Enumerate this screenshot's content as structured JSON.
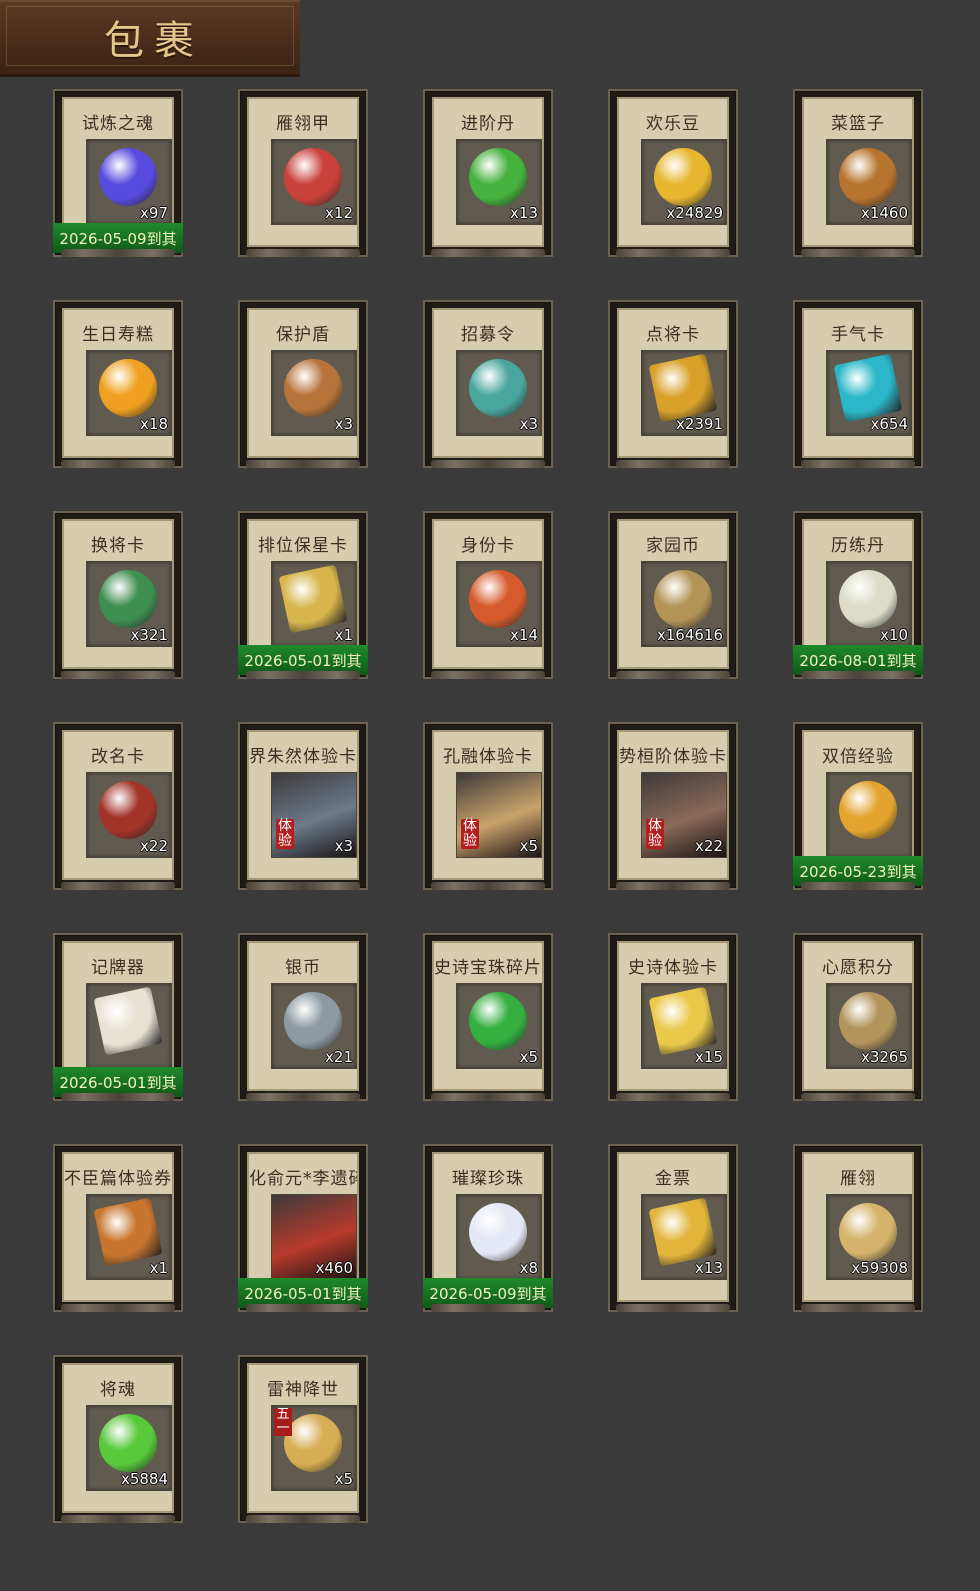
{
  "title": "包裹",
  "items": [
    {
      "name": "试炼之魂",
      "count": "x97",
      "expiry": "2026-05-09到其",
      "icon": "dragon-orb-icon",
      "color": "#5a4be0"
    },
    {
      "name": "雁翎甲",
      "count": "x12",
      "expiry": "",
      "icon": "armor-helmet-icon",
      "color": "#c9423a"
    },
    {
      "name": "进阶丹",
      "count": "x13",
      "expiry": "",
      "icon": "green-orb-icon",
      "color": "#45b23d"
    },
    {
      "name": "欢乐豆",
      "count": "x24829",
      "expiry": "",
      "icon": "gold-beans-icon",
      "color": "#e7b62e"
    },
    {
      "name": "菜篮子",
      "count": "x1460",
      "expiry": "",
      "icon": "basket-icon",
      "color": "#b7742e"
    },
    {
      "name": "生日寿糕",
      "count": "x18",
      "expiry": "",
      "icon": "cake-icon",
      "color": "#f0a020"
    },
    {
      "name": "保护盾",
      "count": "x3",
      "expiry": "",
      "icon": "round-shield-icon",
      "color": "#b8733b"
    },
    {
      "name": "招募令",
      "count": "x3",
      "expiry": "",
      "icon": "recruit-token-icon",
      "color": "#4aa7a0"
    },
    {
      "name": "点将卡",
      "count": "x2391",
      "expiry": "",
      "icon": "general-card-icon",
      "color": "#d9a12a"
    },
    {
      "name": "手气卡",
      "count": "x654",
      "expiry": "",
      "icon": "luck-card-icon",
      "color": "#2bb7c9"
    },
    {
      "name": "换将卡",
      "count": "x321",
      "expiry": "",
      "icon": "swap-general-icon",
      "color": "#3f8f52"
    },
    {
      "name": "排位保星卡",
      "count": "x1",
      "expiry": "2026-05-01到其",
      "icon": "rank-shield-card-icon",
      "color": "#d7b54c"
    },
    {
      "name": "身份卡",
      "count": "x14",
      "expiry": "",
      "icon": "identity-mask-icon",
      "color": "#d65a2c"
    },
    {
      "name": "家园币",
      "count": "x164616",
      "expiry": "",
      "icon": "home-coin-icon",
      "color": "#b39456"
    },
    {
      "name": "历练丹",
      "count": "x10",
      "expiry": "2026-08-01到其",
      "icon": "pearl-stand-icon",
      "color": "#dcdcc8"
    },
    {
      "name": "改名卡",
      "count": "x22",
      "expiry": "",
      "icon": "rename-scroll-icon",
      "color": "#a3342a"
    },
    {
      "name": "界朱然体验卡",
      "count": "x3",
      "expiry": "",
      "icon": "hero-portrait-icon",
      "color": "#6c7a8a",
      "trial": "体验"
    },
    {
      "name": "孔融体验卡",
      "count": "x5",
      "expiry": "",
      "icon": "hero-portrait-icon",
      "color": "#caa36b",
      "trial": "体验"
    },
    {
      "name": "势桓阶体验卡",
      "count": "x22",
      "expiry": "",
      "icon": "hero-portrait-icon",
      "color": "#8a6a58",
      "trial": "体验"
    },
    {
      "name": "双倍经验",
      "count": "",
      "expiry": "2026-05-23到其",
      "icon": "golden-ruyi-icon",
      "color": "#e2a42c"
    },
    {
      "name": "记牌器",
      "count": "",
      "expiry": "2026-05-01到其",
      "icon": "playing-cards-icon",
      "color": "#e8e2d2"
    },
    {
      "name": "银币",
      "count": "x21",
      "expiry": "",
      "icon": "silver-coins-icon",
      "color": "#8e9aa1"
    },
    {
      "name": "史诗宝珠碎片",
      "count": "x5",
      "expiry": "",
      "icon": "green-leaf-shard-icon",
      "color": "#35b040"
    },
    {
      "name": "史诗体验卡",
      "count": "x15",
      "expiry": "",
      "icon": "gold-card-icon",
      "color": "#e9c84a"
    },
    {
      "name": "心愿积分",
      "count": "x3265",
      "expiry": "",
      "icon": "heart-coin-icon",
      "color": "#b3955c"
    },
    {
      "name": "不臣篇体验券",
      "count": "x1",
      "expiry": "",
      "icon": "ticket-icon",
      "color": "#c8762f"
    },
    {
      "name": "化俞元*李遗碎片",
      "count": "x460",
      "expiry": "2026-05-01到其",
      "icon": "hero-portrait-icon",
      "color": "#b83a2c"
    },
    {
      "name": "璀璨珍珠",
      "count": "x8",
      "expiry": "2026-05-09到其",
      "icon": "pearl-icon",
      "color": "#e4e8f4"
    },
    {
      "name": "金票",
      "count": "x13",
      "expiry": "",
      "icon": "gold-ticket-icon",
      "color": "#e2b43a"
    },
    {
      "name": "雁翎",
      "count": "x59308",
      "expiry": "",
      "icon": "feather-icon",
      "color": "#d5b36a"
    },
    {
      "name": "将魂",
      "count": "x5884",
      "expiry": "",
      "icon": "green-crystal-icon",
      "color": "#57c93a"
    },
    {
      "name": "雷神降世",
      "count": "x5",
      "expiry": "",
      "icon": "gift-box-icon",
      "color": "#d7ad55",
      "badge": "五一"
    }
  ]
}
